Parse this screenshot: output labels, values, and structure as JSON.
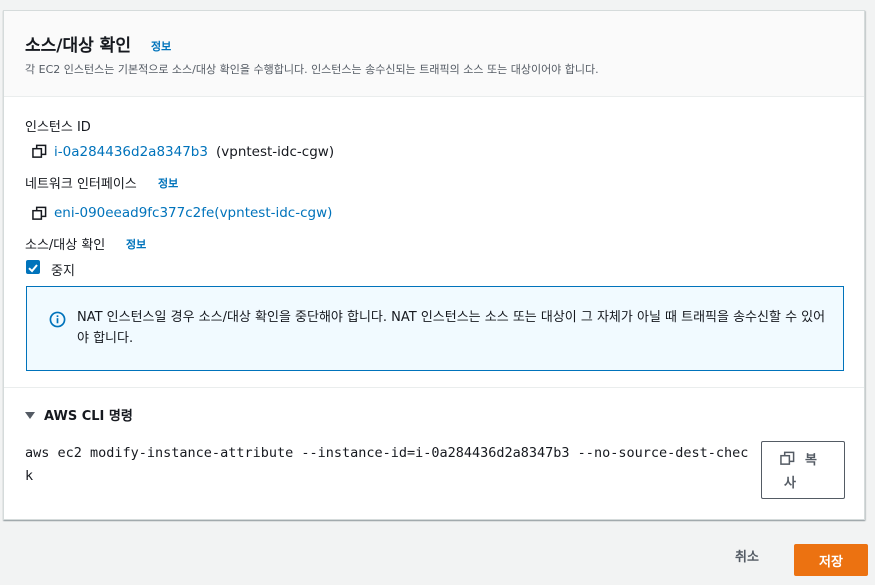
{
  "panel": {
    "title": "소스/대상 확인",
    "title_info": "정보",
    "description": "각 EC2 인스턴스는 기본적으로 소스/대상 확인을 수행합니다. 인스턴스는 송수신되는 트래픽의 소스 또는 대상이어야 합니다."
  },
  "instance": {
    "label": "인스턴스 ID",
    "id_link": "i-0a284436d2a8347b3",
    "name": "(vpntest-idc-cgw)"
  },
  "network_interface": {
    "label": "네트워크 인터페이스",
    "info": "정보",
    "link": "eni-090eead9fc377c2fe(vpntest-idc-cgw)"
  },
  "source_dest_check": {
    "label": "소스/대상 확인",
    "info": "정보",
    "checkbox_label": "중지",
    "checked": true
  },
  "alert": {
    "text": "NAT 인스턴스일 경우 소스/대상 확인을 중단해야 합니다. NAT 인스턴스는 소스 또는 대상이 그 자체가 아닐 때 트래픽을 송수신할 수 있어야 합니다."
  },
  "cli": {
    "expander_label": "AWS CLI 명령",
    "command": "aws ec2 modify-instance-attribute --instance-id=i-0a284436d2a8347b3 --no-source-dest-check",
    "copy_label_line1": "복",
    "copy_label_line2": "사"
  },
  "footer": {
    "cancel_label": "취소",
    "save_label": "저장"
  },
  "colors": {
    "link": "#0073bb",
    "primary_button": "#ec7211",
    "alert_background": "#f1faff"
  },
  "icons": [
    "copy-icon",
    "info-circle-icon",
    "checkmark-icon",
    "caret-down-icon"
  ]
}
